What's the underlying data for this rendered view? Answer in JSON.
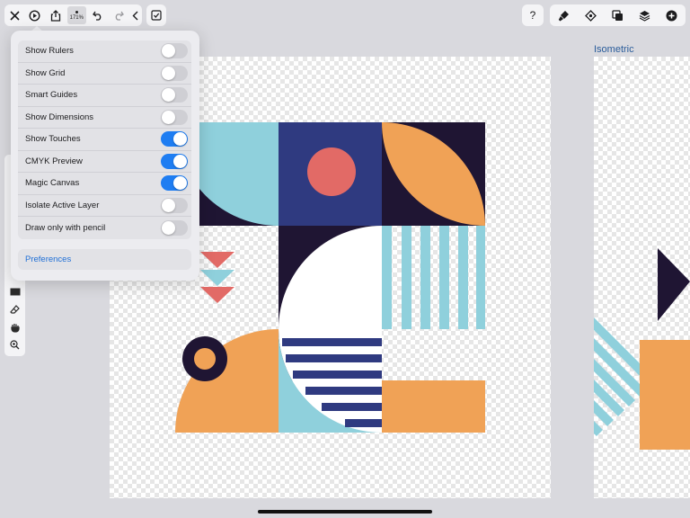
{
  "toolbar": {
    "zoom_label": "171%",
    "icons": [
      "close-icon",
      "play-icon",
      "share-icon",
      "undo-icon",
      "redo-icon",
      "chevron-left-icon",
      "checkbox-icon"
    ],
    "right_icons": [
      "help-icon",
      "brush-icon",
      "selection-icon",
      "transform-icon",
      "layers-icon",
      "add-icon"
    ],
    "help_label": "?"
  },
  "artboards": [
    {
      "label": ""
    },
    {
      "label": "Isometric"
    }
  ],
  "settings": {
    "items": [
      {
        "label": "Show Rulers",
        "on": false
      },
      {
        "label": "Show Grid",
        "on": false
      },
      {
        "label": "Smart Guides",
        "on": false
      },
      {
        "label": "Show Dimensions",
        "on": false
      },
      {
        "label": "Show Touches",
        "on": true
      },
      {
        "label": "CMYK Preview",
        "on": true
      },
      {
        "label": "Magic Canvas",
        "on": true
      },
      {
        "label": "Isolate Active Layer",
        "on": false
      },
      {
        "label": "Draw only with pencil",
        "on": false
      }
    ],
    "preferences_label": "Preferences"
  },
  "colors": {
    "navy": "#2f3a80",
    "dark_purple": "#1f1533",
    "light_blue": "#8fd0dc",
    "orange": "#f0a256",
    "coral": "#e26a66",
    "accent_blue": "#1e7df2"
  }
}
